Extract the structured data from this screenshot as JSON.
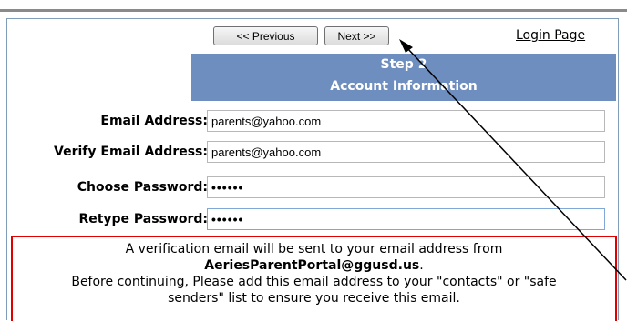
{
  "nav": {
    "previous_label": "<< Previous",
    "next_label": "Next >>",
    "login_label": "Login Page"
  },
  "header": {
    "step": "Step 2",
    "title": "Account Information"
  },
  "form": {
    "email_label": "Email Address:",
    "email_value": "parents@yahoo.com",
    "verify_label": "Verify Email Address:",
    "verify_value": "parents@yahoo.com",
    "password_label": "Choose Password:",
    "password_value": "••••••",
    "retype_label": "Retype Password:",
    "retype_value": "••••••"
  },
  "notice": {
    "line1": "A verification email will be sent to your email address from",
    "email": "AeriesParentPortal@ggusd.us",
    "email_suffix": ".",
    "line3": "Before continuing, Please add this email address to your \"contacts\" or \"safe",
    "line4": "senders\" list to ensure you receive this email."
  },
  "colors": {
    "header_bg": "#6e8ec0",
    "notice_border": "#e00000",
    "annotation_arrow": "#000000"
  }
}
